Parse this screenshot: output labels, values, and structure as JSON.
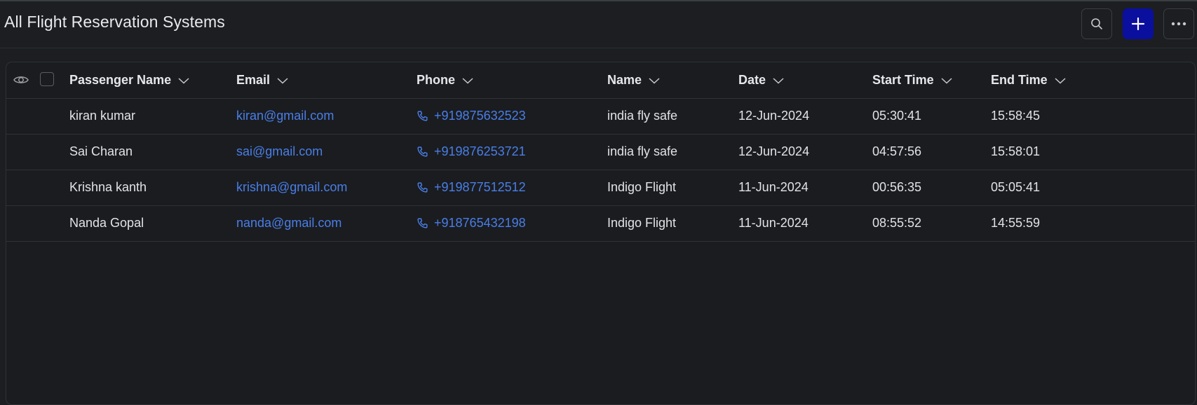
{
  "header": {
    "title": "All Flight Reservation Systems",
    "buttons": [
      {
        "name": "search",
        "icon": "search-icon"
      },
      {
        "name": "add",
        "icon": "plus-icon"
      },
      {
        "name": "more",
        "icon": "more-horizontal-icon"
      }
    ]
  },
  "colors": {
    "background": "#1c1e21",
    "accent_button": "#0b0f9e",
    "link": "#4a7ee8",
    "border": "#2f3236"
  },
  "table": {
    "columns": [
      "Passenger Name",
      "Email",
      "Phone",
      "Name",
      "Date",
      "Start Time",
      "End Time"
    ],
    "rows": [
      {
        "passenger": "kiran kumar",
        "email": "kiran@gmail.com",
        "phone": "+919875632523",
        "name": "india fly safe",
        "date": "12-Jun-2024",
        "start": "05:30:41",
        "end": "15:58:45"
      },
      {
        "passenger": "Sai Charan",
        "email": "sai@gmail.com",
        "phone": "+919876253721",
        "name": "india fly safe",
        "date": "12-Jun-2024",
        "start": "04:57:56",
        "end": "15:58:01"
      },
      {
        "passenger": "Krishna kanth",
        "email": "krishna@gmail.com",
        "phone": "+919877512512",
        "name": "Indigo Flight",
        "date": "11-Jun-2024",
        "start": "00:56:35",
        "end": "05:05:41"
      },
      {
        "passenger": "Nanda Gopal",
        "email": "nanda@gmail.com",
        "phone": "+918765432198",
        "name": "Indigo Flight",
        "date": "11-Jun-2024",
        "start": "08:55:52",
        "end": "14:55:59"
      }
    ]
  }
}
